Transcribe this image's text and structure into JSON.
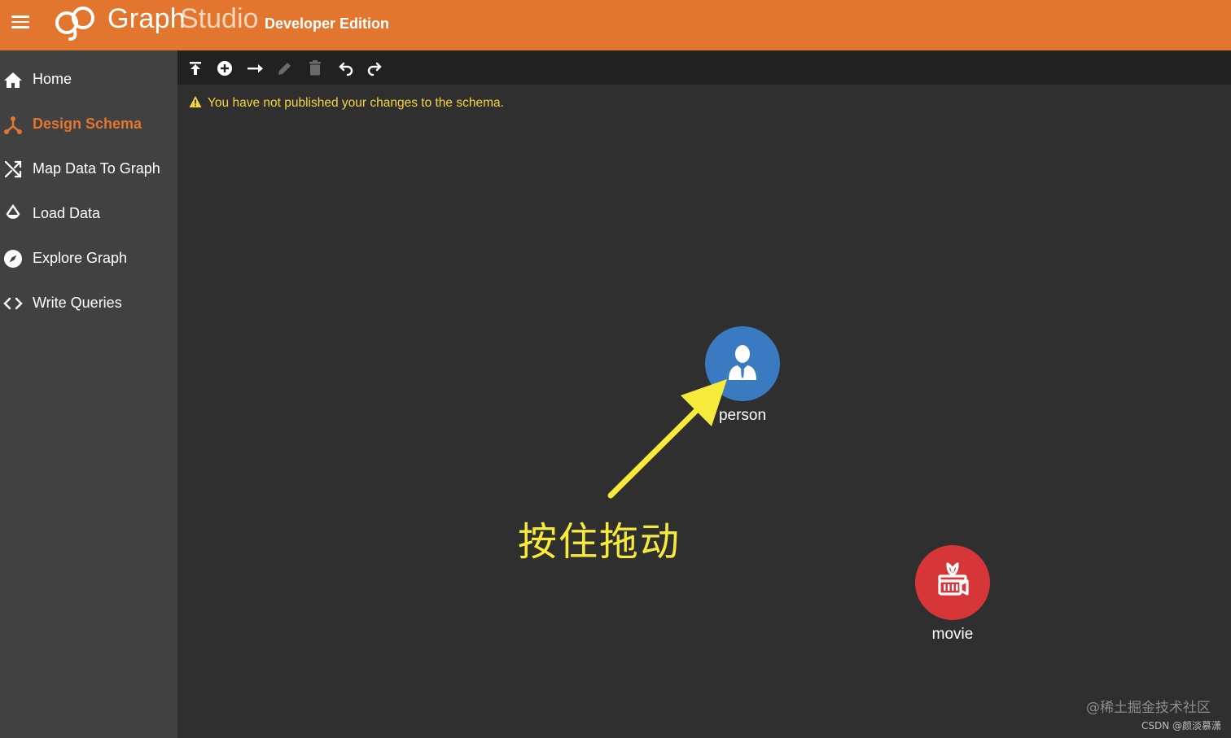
{
  "header": {
    "brand_part1": "Graph",
    "brand_part2": "Studio",
    "edition": "Developer Edition",
    "bar_color": "#e2762e"
  },
  "sidebar": {
    "items": [
      {
        "label": "Home",
        "icon": "home-icon",
        "active": false
      },
      {
        "label": "Design Schema",
        "icon": "schema-icon",
        "active": true
      },
      {
        "label": "Map Data To Graph",
        "icon": "shuffle-icon",
        "active": false
      },
      {
        "label": "Load Data",
        "icon": "drop-icon",
        "active": false
      },
      {
        "label": "Explore Graph",
        "icon": "compass-icon",
        "active": false
      },
      {
        "label": "Write Queries",
        "icon": "code-icon",
        "active": false
      }
    ],
    "active_color": "#e2762e"
  },
  "toolbar": {
    "buttons": [
      {
        "icon": "publish-icon",
        "enabled": true
      },
      {
        "icon": "add-vertex-icon",
        "enabled": true
      },
      {
        "icon": "add-edge-icon",
        "enabled": true
      },
      {
        "icon": "edit-icon",
        "enabled": false
      },
      {
        "icon": "delete-icon",
        "enabled": false
      },
      {
        "icon": "undo-icon",
        "enabled": true
      },
      {
        "icon": "redo-icon",
        "enabled": true
      }
    ]
  },
  "canvas": {
    "warning": "You have not published your changes to the schema.",
    "warning_color": "#f6d43e",
    "nodes": [
      {
        "label": "person",
        "icon": "person-icon",
        "color": "#3a7ac0"
      },
      {
        "label": "movie",
        "icon": "movie-icon",
        "color": "#d63638"
      }
    ],
    "annotation": "按住拖动",
    "annotation_color": "#f6ea3a"
  },
  "watermark": {
    "line1": "@稀土掘金技术社区",
    "line2": "CSDN @颜淡慕潇"
  }
}
